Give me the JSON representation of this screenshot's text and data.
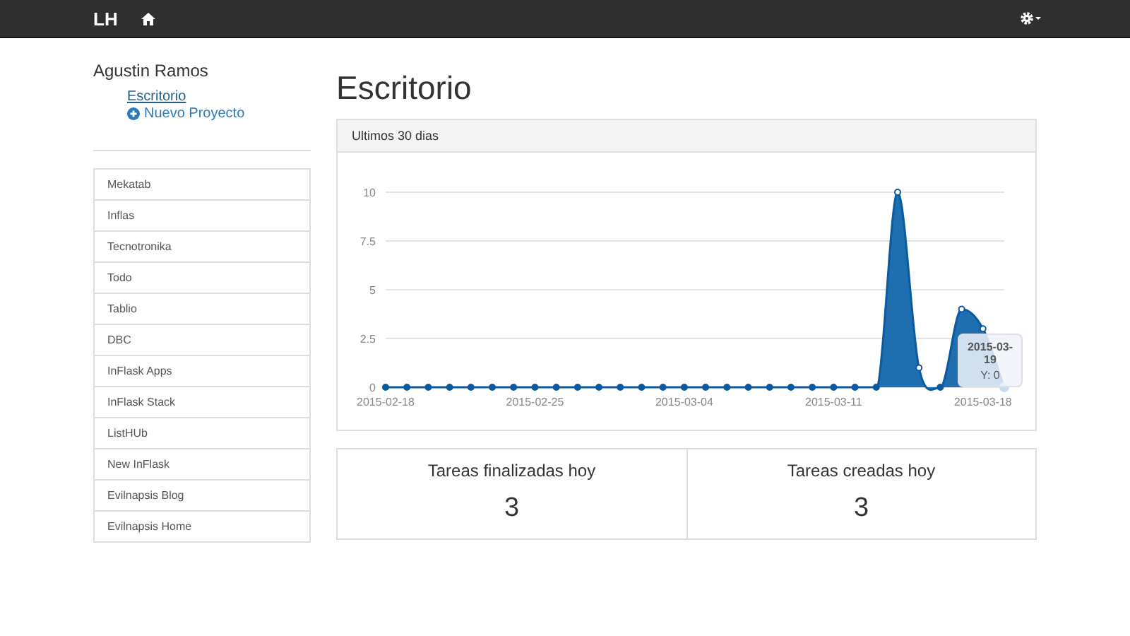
{
  "navbar": {
    "brand": "LH"
  },
  "sidebar": {
    "user": "Agustin Ramos",
    "links": [
      {
        "label": "Escritorio",
        "kind": "link"
      },
      {
        "label": "Nuevo Proyecto",
        "kind": "add"
      }
    ],
    "projects": [
      "Mekatab",
      "Inflas",
      "Tecnotronika",
      "Todo",
      "Tablio",
      "DBC",
      "InFlask Apps",
      "InFlask Stack",
      "ListHUb",
      "New InFlask",
      "Evilnapsis Blog",
      "Evilnapsis Home"
    ]
  },
  "page": {
    "title": "Escritorio"
  },
  "chart_panel": {
    "heading": "Ultimos 30 dias",
    "chart_data": {
      "type": "area",
      "grid": true,
      "categories": [
        "2015-02-18",
        null,
        null,
        null,
        null,
        null,
        null,
        "2015-02-25",
        null,
        null,
        null,
        null,
        null,
        null,
        "2015-03-04",
        null,
        null,
        null,
        null,
        null,
        null,
        "2015-03-11",
        null,
        null,
        null,
        null,
        null,
        null,
        "2015-03-18",
        null
      ],
      "series": [
        {
          "color": "#1f6fb0",
          "values": [
            0,
            0,
            0,
            0,
            0,
            0,
            0,
            0,
            0,
            0,
            0,
            0,
            0,
            0,
            0,
            0,
            0,
            0,
            0,
            0,
            0,
            0,
            0,
            0,
            10,
            1,
            0,
            4,
            3,
            0
          ]
        }
      ],
      "ylim": [
        0,
        10
      ],
      "yticks": [
        {
          "value": 0,
          "label": "0"
        },
        {
          "value": 2.5,
          "label": "2.5"
        },
        {
          "value": 5,
          "label": "5"
        },
        {
          "value": 7.5,
          "label": "7.5"
        },
        {
          "value": 10,
          "label": "10"
        }
      ]
    },
    "tooltip": {
      "title": "2015-03-19",
      "text": "Y: 0"
    }
  },
  "stats": [
    {
      "label": "Tareas finalizadas hoy",
      "value": "3"
    },
    {
      "label": "Tareas creadas hoy",
      "value": "3"
    }
  ]
}
